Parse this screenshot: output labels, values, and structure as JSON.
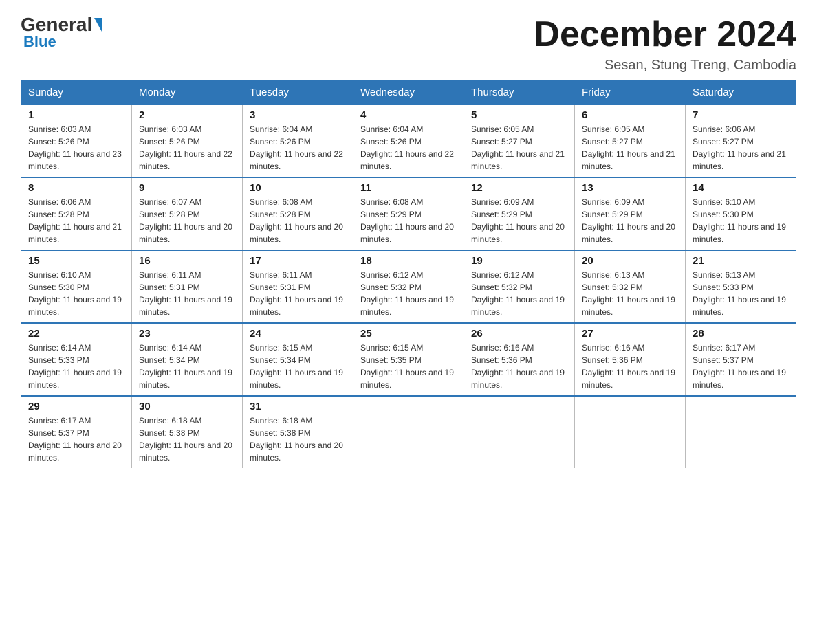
{
  "logo": {
    "general": "General",
    "triangle": "▲",
    "blue": "Blue"
  },
  "header": {
    "month_year": "December 2024",
    "location": "Sesan, Stung Treng, Cambodia"
  },
  "days_of_week": [
    "Sunday",
    "Monday",
    "Tuesday",
    "Wednesday",
    "Thursday",
    "Friday",
    "Saturday"
  ],
  "weeks": [
    [
      {
        "day": "1",
        "sunrise": "6:03 AM",
        "sunset": "5:26 PM",
        "daylight": "11 hours and 23 minutes."
      },
      {
        "day": "2",
        "sunrise": "6:03 AM",
        "sunset": "5:26 PM",
        "daylight": "11 hours and 22 minutes."
      },
      {
        "day": "3",
        "sunrise": "6:04 AM",
        "sunset": "5:26 PM",
        "daylight": "11 hours and 22 minutes."
      },
      {
        "day": "4",
        "sunrise": "6:04 AM",
        "sunset": "5:26 PM",
        "daylight": "11 hours and 22 minutes."
      },
      {
        "day": "5",
        "sunrise": "6:05 AM",
        "sunset": "5:27 PM",
        "daylight": "11 hours and 21 minutes."
      },
      {
        "day": "6",
        "sunrise": "6:05 AM",
        "sunset": "5:27 PM",
        "daylight": "11 hours and 21 minutes."
      },
      {
        "day": "7",
        "sunrise": "6:06 AM",
        "sunset": "5:27 PM",
        "daylight": "11 hours and 21 minutes."
      }
    ],
    [
      {
        "day": "8",
        "sunrise": "6:06 AM",
        "sunset": "5:28 PM",
        "daylight": "11 hours and 21 minutes."
      },
      {
        "day": "9",
        "sunrise": "6:07 AM",
        "sunset": "5:28 PM",
        "daylight": "11 hours and 20 minutes."
      },
      {
        "day": "10",
        "sunrise": "6:08 AM",
        "sunset": "5:28 PM",
        "daylight": "11 hours and 20 minutes."
      },
      {
        "day": "11",
        "sunrise": "6:08 AM",
        "sunset": "5:29 PM",
        "daylight": "11 hours and 20 minutes."
      },
      {
        "day": "12",
        "sunrise": "6:09 AM",
        "sunset": "5:29 PM",
        "daylight": "11 hours and 20 minutes."
      },
      {
        "day": "13",
        "sunrise": "6:09 AM",
        "sunset": "5:29 PM",
        "daylight": "11 hours and 20 minutes."
      },
      {
        "day": "14",
        "sunrise": "6:10 AM",
        "sunset": "5:30 PM",
        "daylight": "11 hours and 19 minutes."
      }
    ],
    [
      {
        "day": "15",
        "sunrise": "6:10 AM",
        "sunset": "5:30 PM",
        "daylight": "11 hours and 19 minutes."
      },
      {
        "day": "16",
        "sunrise": "6:11 AM",
        "sunset": "5:31 PM",
        "daylight": "11 hours and 19 minutes."
      },
      {
        "day": "17",
        "sunrise": "6:11 AM",
        "sunset": "5:31 PM",
        "daylight": "11 hours and 19 minutes."
      },
      {
        "day": "18",
        "sunrise": "6:12 AM",
        "sunset": "5:32 PM",
        "daylight": "11 hours and 19 minutes."
      },
      {
        "day": "19",
        "sunrise": "6:12 AM",
        "sunset": "5:32 PM",
        "daylight": "11 hours and 19 minutes."
      },
      {
        "day": "20",
        "sunrise": "6:13 AM",
        "sunset": "5:32 PM",
        "daylight": "11 hours and 19 minutes."
      },
      {
        "day": "21",
        "sunrise": "6:13 AM",
        "sunset": "5:33 PM",
        "daylight": "11 hours and 19 minutes."
      }
    ],
    [
      {
        "day": "22",
        "sunrise": "6:14 AM",
        "sunset": "5:33 PM",
        "daylight": "11 hours and 19 minutes."
      },
      {
        "day": "23",
        "sunrise": "6:14 AM",
        "sunset": "5:34 PM",
        "daylight": "11 hours and 19 minutes."
      },
      {
        "day": "24",
        "sunrise": "6:15 AM",
        "sunset": "5:34 PM",
        "daylight": "11 hours and 19 minutes."
      },
      {
        "day": "25",
        "sunrise": "6:15 AM",
        "sunset": "5:35 PM",
        "daylight": "11 hours and 19 minutes."
      },
      {
        "day": "26",
        "sunrise": "6:16 AM",
        "sunset": "5:36 PM",
        "daylight": "11 hours and 19 minutes."
      },
      {
        "day": "27",
        "sunrise": "6:16 AM",
        "sunset": "5:36 PM",
        "daylight": "11 hours and 19 minutes."
      },
      {
        "day": "28",
        "sunrise": "6:17 AM",
        "sunset": "5:37 PM",
        "daylight": "11 hours and 19 minutes."
      }
    ],
    [
      {
        "day": "29",
        "sunrise": "6:17 AM",
        "sunset": "5:37 PM",
        "daylight": "11 hours and 20 minutes."
      },
      {
        "day": "30",
        "sunrise": "6:18 AM",
        "sunset": "5:38 PM",
        "daylight": "11 hours and 20 minutes."
      },
      {
        "day": "31",
        "sunrise": "6:18 AM",
        "sunset": "5:38 PM",
        "daylight": "11 hours and 20 minutes."
      },
      null,
      null,
      null,
      null
    ]
  ]
}
